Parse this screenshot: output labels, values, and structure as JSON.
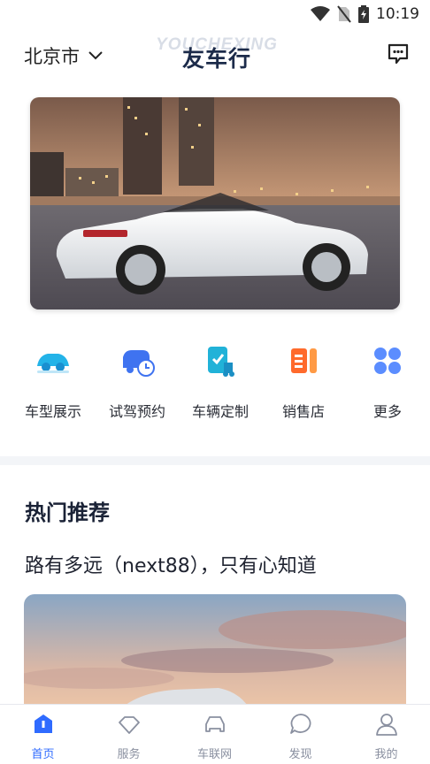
{
  "status_bar": {
    "time": "10:19",
    "icons": [
      "wifi-icon",
      "no-sim-icon",
      "battery-icon"
    ]
  },
  "header": {
    "city": "北京市",
    "brand": "友车行",
    "brand_watermark": "YOUCHEXING",
    "chat_icon": "chat-icon"
  },
  "quick_entries": [
    {
      "label": "车型展示",
      "icon": "car-display-icon"
    },
    {
      "label": "试驾预约",
      "icon": "test-drive-icon"
    },
    {
      "label": "车辆定制",
      "icon": "custom-vehicle-icon"
    },
    {
      "label": "销售店",
      "icon": "dealer-icon"
    },
    {
      "label": "更多",
      "icon": "more-grid-icon"
    }
  ],
  "recommend": {
    "section_title": "热门推荐",
    "article_title": "路有多远（next88），只有心知道"
  },
  "tabbar": [
    {
      "label": "首页",
      "icon": "home-icon",
      "active": true
    },
    {
      "label": "服务",
      "icon": "service-icon",
      "active": false
    },
    {
      "label": "车联网",
      "icon": "car-net-icon",
      "active": false
    },
    {
      "label": "发现",
      "icon": "discover-icon",
      "active": false
    },
    {
      "label": "我的",
      "icon": "profile-icon",
      "active": false
    }
  ],
  "colors": {
    "accent": "#2f6bff",
    "brand_text": "#1c2b4a",
    "tab_inactive": "#8a90a0"
  }
}
